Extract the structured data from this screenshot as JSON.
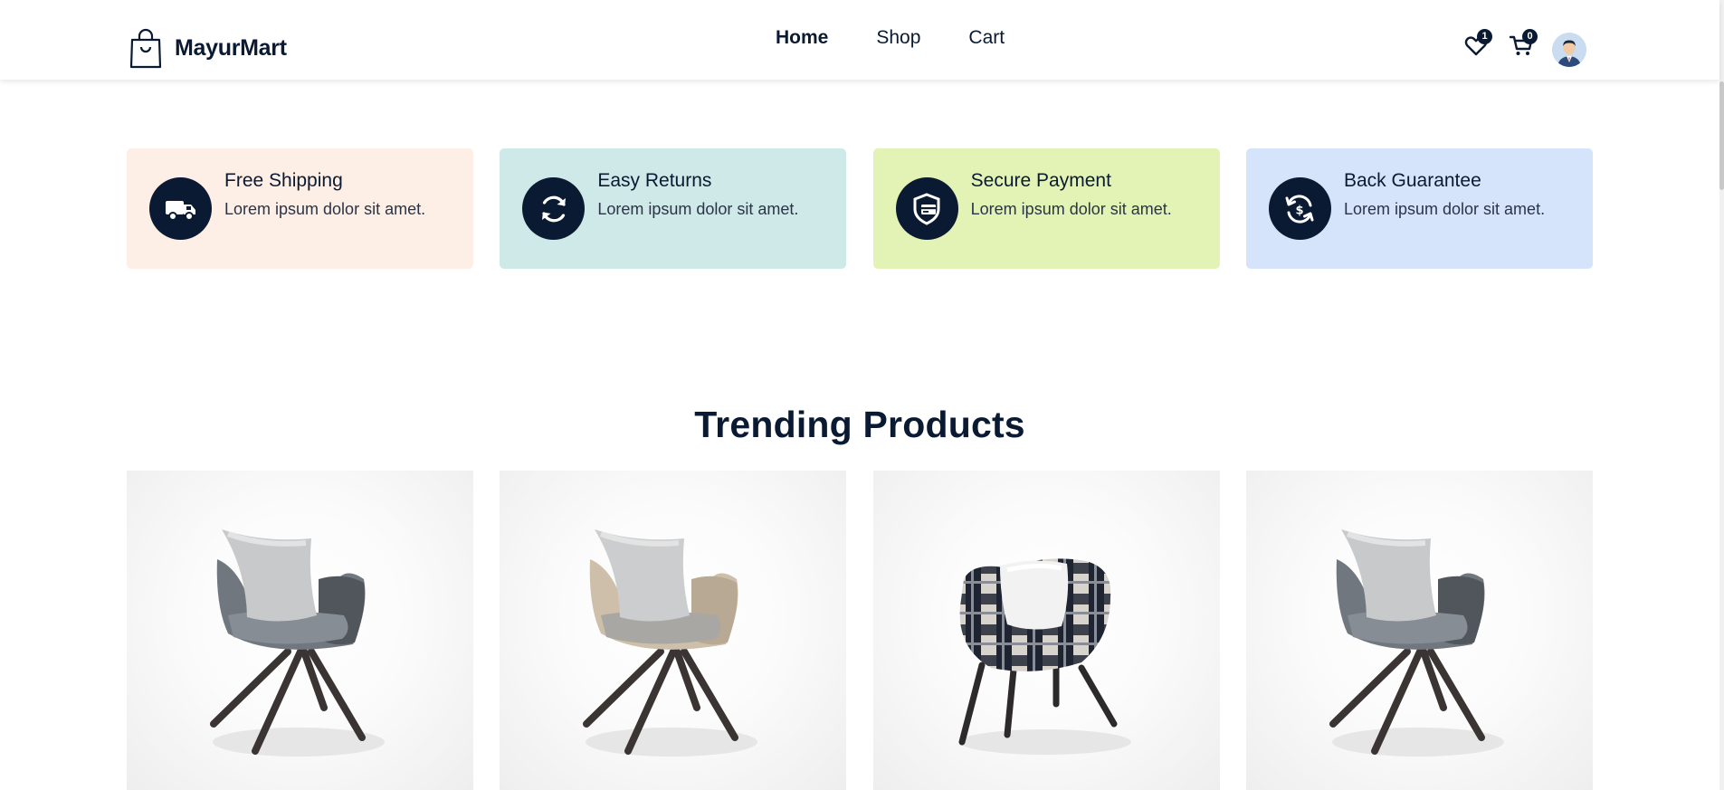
{
  "brand": {
    "name": "MayurMart",
    "icon": "shopping-bag-icon"
  },
  "nav": {
    "items": [
      {
        "label": "Home",
        "active": true
      },
      {
        "label": "Shop",
        "active": false
      },
      {
        "label": "Cart",
        "active": false
      }
    ]
  },
  "header_icons": {
    "wishlist": {
      "icon": "heart-icon",
      "count": "1"
    },
    "cart": {
      "icon": "cart-icon",
      "count": "0"
    },
    "user": {
      "icon": "user-avatar-icon"
    }
  },
  "features": [
    {
      "title": "Free Shipping",
      "description": "Lorem ipsum dolor sit amet.",
      "icon": "truck-icon",
      "bg": "#fdeee6"
    },
    {
      "title": "Easy Returns",
      "description": "Lorem ipsum dolor sit amet.",
      "icon": "refresh-icon",
      "bg": "#cfe8e8"
    },
    {
      "title": "Secure Payment",
      "description": "Lorem ipsum dolor sit amet.",
      "icon": "shield-card-icon",
      "bg": "#e3f3b5"
    },
    {
      "title": "Back Guarantee",
      "description": "Lorem ipsum dolor sit amet.",
      "icon": "money-back-icon",
      "bg": "#d6e4fb"
    }
  ],
  "section": {
    "title": "Trending Products"
  },
  "products": [
    {
      "image": "grey-swivel-chair"
    },
    {
      "image": "beige-swivel-chair"
    },
    {
      "image": "plaid-armchair"
    },
    {
      "image": "grey-swivel-chair"
    }
  ],
  "colors": {
    "navy": "#0b1a33",
    "white": "#ffffff"
  }
}
